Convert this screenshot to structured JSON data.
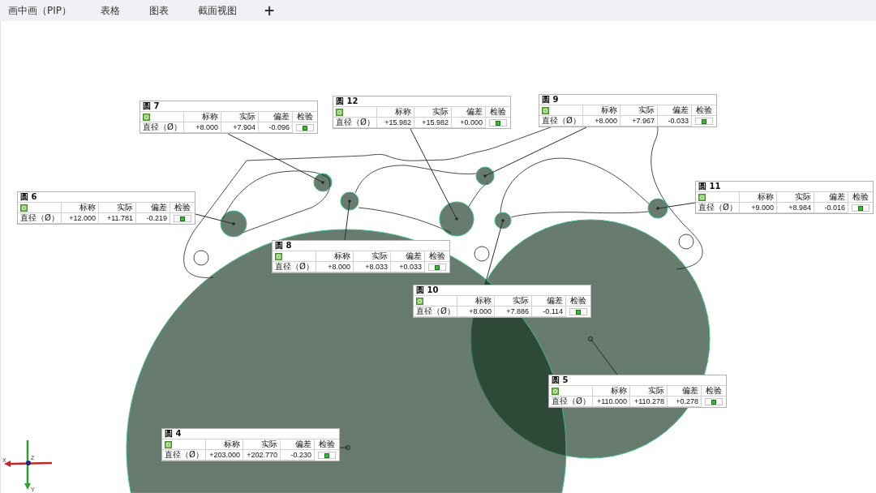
{
  "tabs": [
    {
      "label": "画中画（PIP）"
    },
    {
      "label": "表格"
    },
    {
      "label": "图表"
    },
    {
      "label": "截面视图"
    }
  ],
  "add_tab": "+",
  "features": [
    {
      "title": "圆 7",
      "columns": [
        "标称",
        "实际",
        "偏差",
        "检验"
      ],
      "row_label": "直径（Ø）",
      "nominal": "+8.000",
      "actual": "+7.904",
      "deviation": "-0.096",
      "pass": true
    },
    {
      "title": "圆 12",
      "columns": [
        "标称",
        "实际",
        "偏差",
        "检验"
      ],
      "row_label": "直径（Ø）",
      "nominal": "+15.982",
      "actual": "+15.982",
      "deviation": "+0.000",
      "pass": true
    },
    {
      "title": "圆 9",
      "columns": [
        "标称",
        "实际",
        "偏差",
        "检验"
      ],
      "row_label": "直径（Ø）",
      "nominal": "+8.000",
      "actual": "+7.967",
      "deviation": "-0.033",
      "pass": true
    },
    {
      "title": "圆 6",
      "columns": [
        "标称",
        "实际",
        "偏差",
        "检验"
      ],
      "row_label": "直径（Ø）",
      "nominal": "+12.000",
      "actual": "+11.781",
      "deviation": "-0.219",
      "pass": true
    },
    {
      "title": "圆 11",
      "columns": [
        "标称",
        "实际",
        "偏差",
        "检验"
      ],
      "row_label": "直径（Ø）",
      "nominal": "+9.000",
      "actual": "+8.984",
      "deviation": "-0.016",
      "pass": true
    },
    {
      "title": "圆 8",
      "columns": [
        "标称",
        "实际",
        "偏差",
        "检验"
      ],
      "row_label": "直径（Ø）",
      "nominal": "+8.000",
      "actual": "+8.033",
      "deviation": "+0.033",
      "pass": true
    },
    {
      "title": "圆 10",
      "columns": [
        "标称",
        "实际",
        "偏差",
        "检验"
      ],
      "row_label": "直径（Ø）",
      "nominal": "+8.000",
      "actual": "+7.886",
      "deviation": "-0.114",
      "pass": true
    },
    {
      "title": "圆 5",
      "columns": [
        "标称",
        "实际",
        "偏差",
        "检验"
      ],
      "row_label": "直径（Ø）",
      "nominal": "+110.000",
      "actual": "+110.278",
      "deviation": "+0.278",
      "pass": true
    },
    {
      "title": "圆 4",
      "columns": [
        "标称",
        "实际",
        "偏差",
        "检验"
      ],
      "row_label": "直径（Ø）",
      "nominal": "+203.000",
      "actual": "+202.770",
      "deviation": "-0.230",
      "pass": true
    }
  ],
  "axes": {
    "x": "X",
    "y": "Y",
    "z": "Z"
  }
}
